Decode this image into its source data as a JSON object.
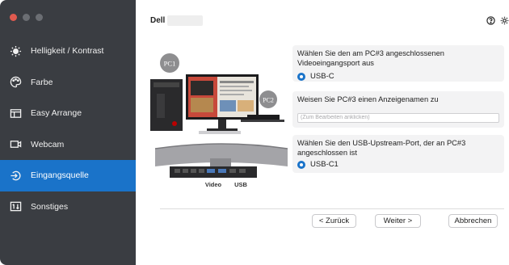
{
  "window": {
    "controls": [
      "close",
      "minimize",
      "maximize"
    ]
  },
  "sidebar": {
    "items": [
      {
        "label": "Helligkeit / Kontrast",
        "icon": "brightness-icon"
      },
      {
        "label": "Farbe",
        "icon": "palette-icon"
      },
      {
        "label": "Easy Arrange",
        "icon": "layout-icon"
      },
      {
        "label": "Webcam",
        "icon": "webcam-icon"
      },
      {
        "label": "Eingangsquelle",
        "icon": "input-source-icon",
        "active": true
      },
      {
        "label": "Sonstiges",
        "icon": "other-settings-icon"
      }
    ]
  },
  "header": {
    "model": "Dell",
    "icons": [
      "help-icon",
      "settings-icon"
    ]
  },
  "illustration": {
    "labels": {
      "pc1": "PC1",
      "pc2": "PC2",
      "video": "Video",
      "usb": "USB"
    }
  },
  "panels": {
    "video_port": {
      "question": "Wählen Sie den am PC#3 angeschlossenen Videoeingangsport aus",
      "selected": "USB-C"
    },
    "display_name": {
      "question": "Weisen Sie PC#3 einen Anzeigenamen zu",
      "placeholder": "(Zum Bearbeiten anklicken)"
    },
    "usb_upstream": {
      "question": "Wählen Sie den USB-Upstream-Port, der an PC#3 angeschlossen ist",
      "selected": "USB-C1"
    }
  },
  "footer": {
    "back": "< Zurück",
    "next": "Weiter >",
    "cancel": "Abbrechen"
  },
  "colors": {
    "accent": "#1a73c9",
    "sidebar_bg": "#3a3d42",
    "close": "#e05a4f"
  }
}
